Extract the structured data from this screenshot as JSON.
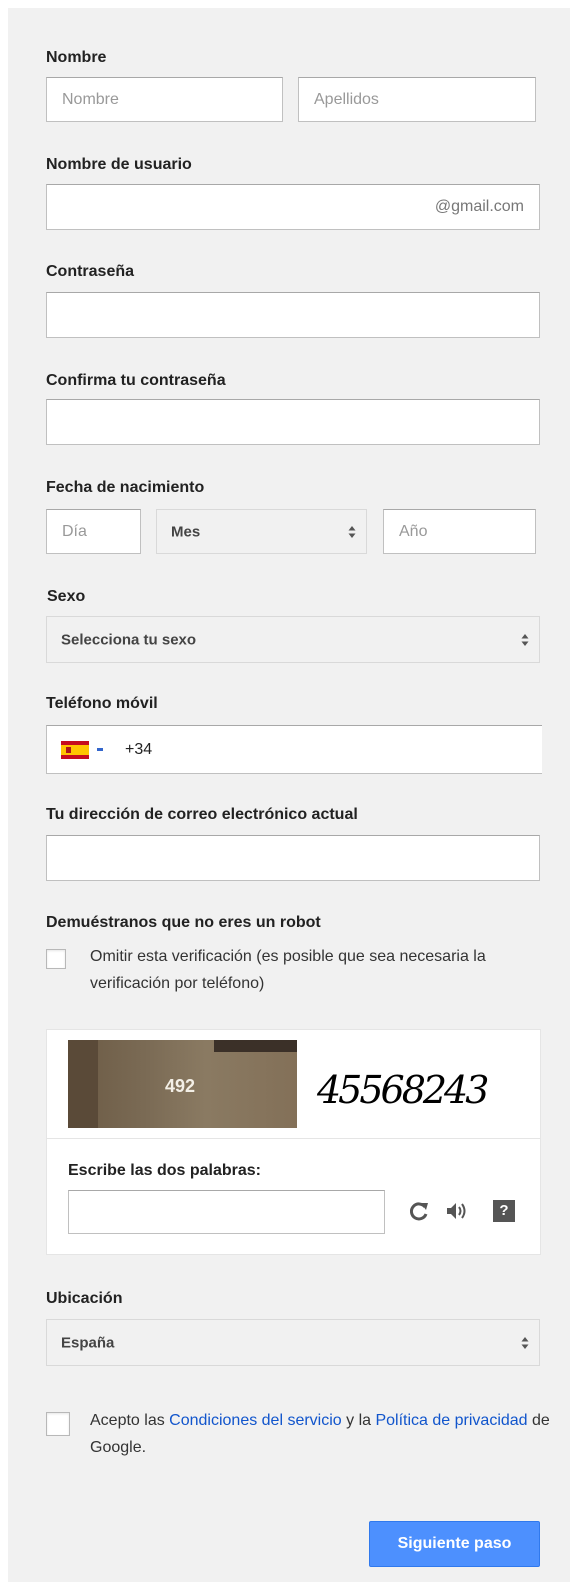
{
  "name": {
    "label": "Nombre",
    "first_placeholder": "Nombre",
    "last_placeholder": "Apellidos"
  },
  "username": {
    "label": "Nombre de usuario",
    "suffix": "@gmail.com"
  },
  "password": {
    "label": "Contraseña"
  },
  "confirm_password": {
    "label": "Confirma tu contraseña"
  },
  "birthdate": {
    "label": "Fecha de nacimiento",
    "day_placeholder": "Día",
    "month_value": "Mes",
    "year_placeholder": "Año"
  },
  "gender": {
    "label": "Sexo",
    "value": "Selecciona tu sexo"
  },
  "phone": {
    "label": "Teléfono móvil",
    "country_code": "+34",
    "flag_icon": "spain-flag-icon"
  },
  "current_email": {
    "label": "Tu dirección de correo electrónico actual"
  },
  "robot": {
    "label": "Demuéstranos que no eres un robot",
    "skip_text": "Omitir esta verificación (es posible que sea necesaria la verificación por teléfono)",
    "captcha_photo_text": "492",
    "captcha_word_text": "45568243",
    "prompt": "Escribe las dos palabras:",
    "icons": [
      "refresh-icon",
      "audio-icon",
      "help-icon"
    ],
    "help_glyph": "?"
  },
  "location": {
    "label": "Ubicación",
    "value": "España"
  },
  "terms": {
    "prefix": "Acepto las ",
    "tos_link": "Condiciones del servicio",
    "middle": " y la ",
    "privacy_link": "Política de privacidad",
    "suffix": " de Google."
  },
  "submit": {
    "label": "Siguiente paso"
  },
  "colors": {
    "panel_bg": "#f1f1f1",
    "link": "#1155cc",
    "button": "#4d90fe"
  }
}
